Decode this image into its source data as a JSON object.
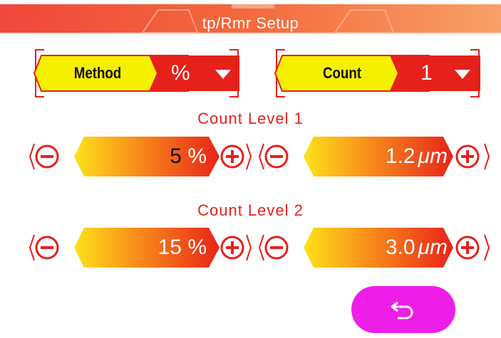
{
  "header": {
    "title": "tp/Rmr  Setup"
  },
  "method": {
    "label": "Method",
    "value": "%"
  },
  "count": {
    "label": "Count",
    "value": "1"
  },
  "levels": [
    {
      "label": "Count  Level  1",
      "percent": "5",
      "percent_unit": "%",
      "depth": "1.2",
      "depth_unit": "μm"
    },
    {
      "label": "Count  Level  2",
      "percent": "15",
      "percent_unit": "%",
      "depth": "3.0",
      "depth_unit": "μm"
    }
  ],
  "colors": {
    "accent_red": "#e6201a",
    "yellow": "#f5f000",
    "back_button": "#ee1ee8",
    "header": "#f26b3a"
  },
  "icons": {
    "minus": "minus-circle-icon",
    "plus": "plus-circle-icon",
    "dropdown": "triangle-down-icon",
    "back": "return-arrow-icon"
  }
}
